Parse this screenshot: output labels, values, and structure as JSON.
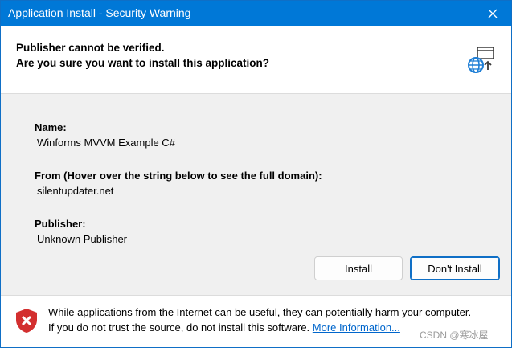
{
  "titlebar": {
    "title": "Application Install - Security Warning",
    "close_icon": "close-icon",
    "color": "#0078d7"
  },
  "header": {
    "line1": "Publisher cannot be verified.",
    "line2": "Are you sure you want to install this application?",
    "icon": "globe-install-icon"
  },
  "details": {
    "name_label": "Name:",
    "name_value": "Winforms MVVM Example C#",
    "from_label": "From (Hover over the string below to see the full domain):",
    "from_value": "silentupdater.net",
    "publisher_label": "Publisher:",
    "publisher_value": "Unknown Publisher"
  },
  "buttons": {
    "install": "Install",
    "dont_install": "Don't Install"
  },
  "footer": {
    "icon": "shield-warning-icon",
    "line1": "While applications from the Internet can be useful, they can potentially harm your computer.",
    "line2_prefix": "If you do not trust the source, do not install this software.",
    "more_info": "More Information...",
    "watermark": "CSDN @寒冰屋"
  },
  "colors": {
    "accent": "#0078d7",
    "link": "#0066cc",
    "shield": "#d32f2f"
  }
}
